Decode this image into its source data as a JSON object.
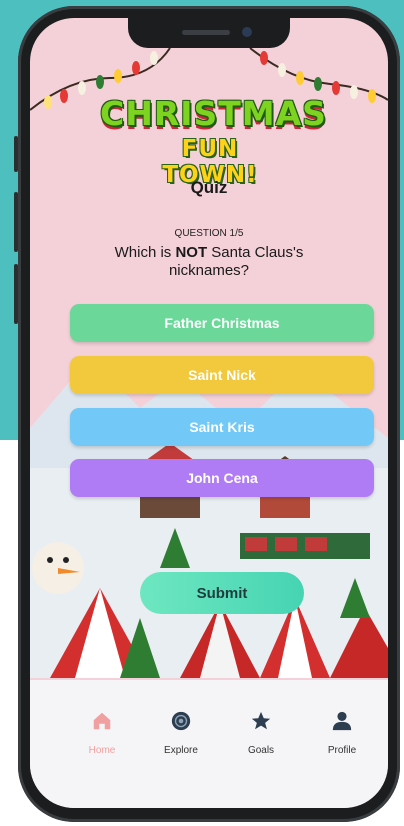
{
  "app": {
    "logo_line1": "CHRISTMAS",
    "logo_line2": "FUN TOWN!",
    "page_title": "Quiz"
  },
  "quiz": {
    "question_number": "QUESTION 1/5",
    "question_prefix": "Which is ",
    "question_emphasis": "NOT",
    "question_suffix": " Santa Claus's nicknames?",
    "answers": [
      {
        "label": "Father Christmas",
        "color": "#6bd89a"
      },
      {
        "label": "Saint Nick",
        "color": "#f2c93d"
      },
      {
        "label": "Saint Kris",
        "color": "#72c8f7"
      },
      {
        "label": "John Cena",
        "color": "#b07cf6"
      }
    ],
    "submit_label": "Submit"
  },
  "tabbar": {
    "items": [
      {
        "label": "Home",
        "icon": "home-icon",
        "active": true
      },
      {
        "label": "Explore",
        "icon": "explore-icon",
        "active": false
      },
      {
        "label": "Goals",
        "icon": "star-icon",
        "active": false
      },
      {
        "label": "Profile",
        "icon": "profile-icon",
        "active": false
      }
    ]
  },
  "colors": {
    "background_teal": "#4dbfbf",
    "screen_pink": "#f4d1d8",
    "active_tab": "#f0a0a0"
  }
}
